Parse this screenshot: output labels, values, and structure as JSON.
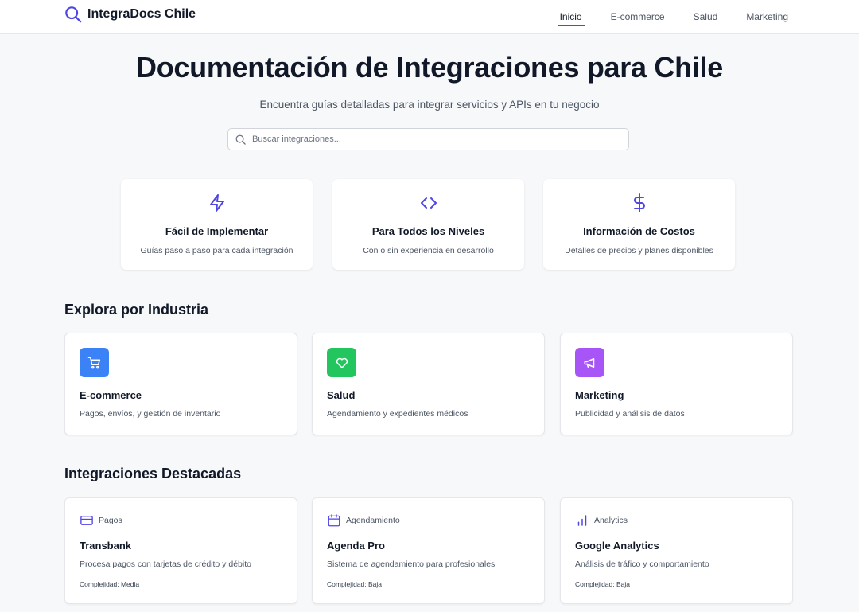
{
  "header": {
    "brand": "IntegraDocs Chile",
    "nav": [
      {
        "label": "Inicio",
        "active": true
      },
      {
        "label": "E-commerce",
        "active": false
      },
      {
        "label": "Salud",
        "active": false
      },
      {
        "label": "Marketing",
        "active": false
      }
    ]
  },
  "hero": {
    "title": "Documentación de Integraciones para Chile",
    "subtitle": "Encuentra guías detalladas para integrar servicios y APIs en tu negocio",
    "search_placeholder": "Buscar integraciones..."
  },
  "features": [
    {
      "icon": "lightning-icon",
      "title": "Fácil de Implementar",
      "desc": "Guías paso a paso para cada integración"
    },
    {
      "icon": "code-icon",
      "title": "Para Todos los Niveles",
      "desc": "Con o sin experiencia en desarrollo"
    },
    {
      "icon": "dollar-icon",
      "title": "Información de Costos",
      "desc": "Detalles de precios y planes disponibles"
    }
  ],
  "industries": {
    "title": "Explora por Industria",
    "items": [
      {
        "icon": "cart-icon",
        "color": "#3b82f6",
        "title": "E-commerce",
        "desc": "Pagos, envíos, y gestión de inventario"
      },
      {
        "icon": "heart-icon",
        "color": "#22c55e",
        "title": "Salud",
        "desc": "Agendamiento y expedientes médicos"
      },
      {
        "icon": "megaphone-icon",
        "color": "#a855f7",
        "title": "Marketing",
        "desc": "Publicidad y análisis de datos"
      }
    ]
  },
  "integrations": {
    "title": "Integraciones Destacadas",
    "items": [
      {
        "icon": "credit-card-icon",
        "category": "Pagos",
        "title": "Transbank",
        "desc": "Procesa pagos con tarjetas de crédito y débito",
        "complexity": "Complejidad: Media"
      },
      {
        "icon": "calendar-icon",
        "category": "Agendamiento",
        "title": "Agenda Pro",
        "desc": "Sistema de agendamiento para profesionales",
        "complexity": "Complejidad: Baja"
      },
      {
        "icon": "bar-chart-icon",
        "category": "Analytics",
        "title": "Google Analytics",
        "desc": "Análisis de tráfico y comportamiento",
        "complexity": "Complejidad: Baja"
      }
    ]
  },
  "colors": {
    "accent": "#4f46e5",
    "background": "#f7f8fa"
  }
}
